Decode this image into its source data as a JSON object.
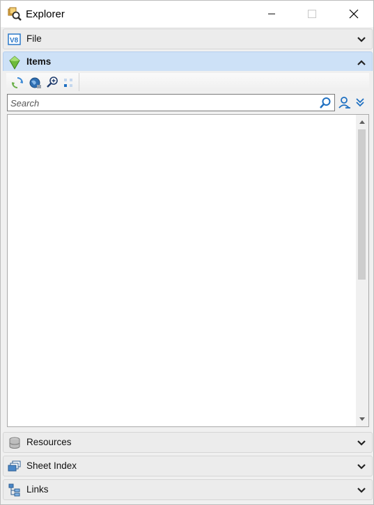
{
  "window": {
    "title": "Explorer"
  },
  "panels": {
    "file": {
      "label": "File",
      "icon": "v8-icon"
    },
    "items": {
      "label": "Items",
      "icon": "green-gem-icon",
      "toolbar": [
        {
          "icon": "refresh-icon"
        },
        {
          "icon": "globe-icon"
        },
        {
          "icon": "zoom-in-icon"
        },
        {
          "icon": "grid-dots-icon"
        }
      ],
      "search": {
        "placeholder": "Search",
        "value": ""
      }
    },
    "resources": {
      "label": "Resources",
      "icon": "database-icon"
    },
    "sheet_index": {
      "label": "Sheet Index",
      "icon": "sheets-icon"
    },
    "links": {
      "label": "Links",
      "icon": "tree-icon"
    }
  },
  "colors": {
    "active_header": "#cde1f7",
    "accent_blue": "#1e6fc1"
  }
}
